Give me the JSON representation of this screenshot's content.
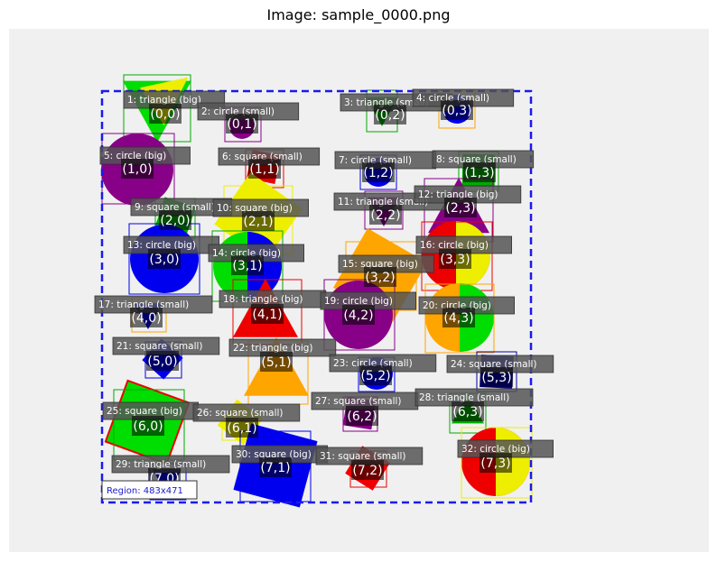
{
  "title": "Image: sample_0000.png",
  "region_label": "Region: 483x471",
  "colors": {
    "canvas": "#f0f0f0",
    "region_border": "#1a1aee",
    "label_box": "#555555"
  },
  "objects": [
    {
      "id": 1,
      "label": "1: triangle (big)",
      "grid": "(0,0)",
      "shape": "triangle",
      "color": "#00dd00"
    },
    {
      "id": 2,
      "label": "2: circle (small)",
      "grid": "(0,1)",
      "shape": "circle",
      "color": "#880088"
    },
    {
      "id": 3,
      "label": "3: triangle (small)",
      "grid": "(0,2)",
      "shape": "triangle",
      "color": "#00aa00"
    },
    {
      "id": 4,
      "label": "4: circle (small)",
      "grid": "(0,3)",
      "shape": "circle",
      "color": "#0000ee"
    },
    {
      "id": 5,
      "label": "5: circle (big)",
      "grid": "(1,0)",
      "shape": "circle",
      "color": "#880088"
    },
    {
      "id": 6,
      "label": "6: square (small)",
      "grid": "(1,1)",
      "shape": "square",
      "color": "#ee0000"
    },
    {
      "id": 7,
      "label": "7: circle (small)",
      "grid": "(1,2)",
      "shape": "circle",
      "color": "#0000ee"
    },
    {
      "id": 8,
      "label": "8: square (small)",
      "grid": "(1,3)",
      "shape": "square",
      "color": "#00aa00"
    },
    {
      "id": 9,
      "label": "9: square (small)",
      "grid": "(2,0)",
      "shape": "square",
      "color": "#00aa00"
    },
    {
      "id": 10,
      "label": "10: square (big)",
      "grid": "(2,1)",
      "shape": "square",
      "color": "#eeee00"
    },
    {
      "id": 11,
      "label": "11: triangle (small)",
      "grid": "(2,2)",
      "shape": "triangle",
      "color": "#880088"
    },
    {
      "id": 12,
      "label": "12: triangle (big)",
      "grid": "(2,3)",
      "shape": "triangle",
      "color": "#880088"
    },
    {
      "id": 13,
      "label": "13: circle (big)",
      "grid": "(3,0)",
      "shape": "circle",
      "color": "#0000ee"
    },
    {
      "id": 14,
      "label": "14: circle (big)",
      "grid": "(3,1)",
      "shape": "circle",
      "color": "#00dd00"
    },
    {
      "id": 15,
      "label": "15: square (big)",
      "grid": "(3,2)",
      "shape": "square",
      "color": "#ffa500"
    },
    {
      "id": 16,
      "label": "16: circle (big)",
      "grid": "(3,3)",
      "shape": "circle",
      "color": "#ee0000"
    },
    {
      "id": 17,
      "label": "17: triangle (small)",
      "grid": "(4,0)",
      "shape": "triangle",
      "color": "#0000ee"
    },
    {
      "id": 18,
      "label": "18: triangle (big)",
      "grid": "(4,1)",
      "shape": "triangle",
      "color": "#ee0000"
    },
    {
      "id": 19,
      "label": "19: circle (big)",
      "grid": "(4,2)",
      "shape": "circle",
      "color": "#880088"
    },
    {
      "id": 20,
      "label": "20: circle (big)",
      "grid": "(4,3)",
      "shape": "circle",
      "color": "#ffa500"
    },
    {
      "id": 21,
      "label": "21: square (small)",
      "grid": "(5,0)",
      "shape": "square",
      "color": "#0000ee"
    },
    {
      "id": 22,
      "label": "22: triangle (big)",
      "grid": "(5,1)",
      "shape": "triangle",
      "color": "#ffa500"
    },
    {
      "id": 23,
      "label": "23: circle (small)",
      "grid": "(5,2)",
      "shape": "circle",
      "color": "#0000ee"
    },
    {
      "id": 24,
      "label": "24: square (small)",
      "grid": "(5,3)",
      "shape": "square",
      "color": "#0000aa"
    },
    {
      "id": 25,
      "label": "25: square (big)",
      "grid": "(6,0)",
      "shape": "square",
      "color": "#00dd00"
    },
    {
      "id": 26,
      "label": "26: square (small)",
      "grid": "(6,1)",
      "shape": "square",
      "color": "#eeee00"
    },
    {
      "id": 27,
      "label": "27: square (small)",
      "grid": "(6,2)",
      "shape": "square",
      "color": "#880088"
    },
    {
      "id": 28,
      "label": "28: triangle (small)",
      "grid": "(6,3)",
      "shape": "triangle",
      "color": "#00aa00"
    },
    {
      "id": 29,
      "label": "29: triangle (small)",
      "grid": "(7,0)",
      "shape": "triangle",
      "color": "#0000ee"
    },
    {
      "id": 30,
      "label": "30: square (big)",
      "grid": "(7,1)",
      "shape": "square",
      "color": "#0000ee"
    },
    {
      "id": 31,
      "label": "31: square (small)",
      "grid": "(7,2)",
      "shape": "square",
      "color": "#ee0000"
    },
    {
      "id": 32,
      "label": "32: circle (big)",
      "grid": "(7,3)",
      "shape": "circle",
      "color": "#ee0000"
    }
  ]
}
